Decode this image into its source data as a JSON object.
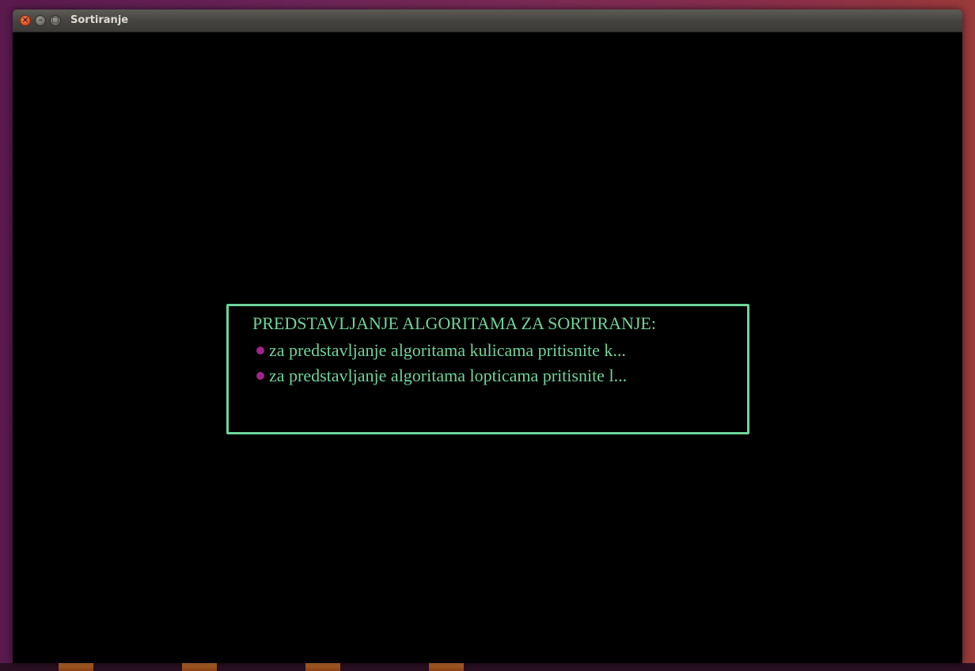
{
  "window": {
    "title": "Sortiranje",
    "controls": {
      "close": "×",
      "minimize": "–",
      "maximize": "□"
    }
  },
  "menu": {
    "heading": "PREDSTAVLJANJE ALGORITAMA ZA SORTIRANJE:",
    "items": [
      {
        "text": "za predstavljanje algoritama kulicama pritisnite k..."
      },
      {
        "text": "za predstavljanje algoritama lopticama pritisnite l..."
      }
    ]
  },
  "colors": {
    "text": "#6fd49a",
    "border": "#6fd49a",
    "bullet": "#a0258a",
    "background": "#000000"
  },
  "icons": {
    "close": "close-icon",
    "minimize": "minimize-icon",
    "maximize": "maximize-icon",
    "bullet": "bullet-dot-icon"
  }
}
